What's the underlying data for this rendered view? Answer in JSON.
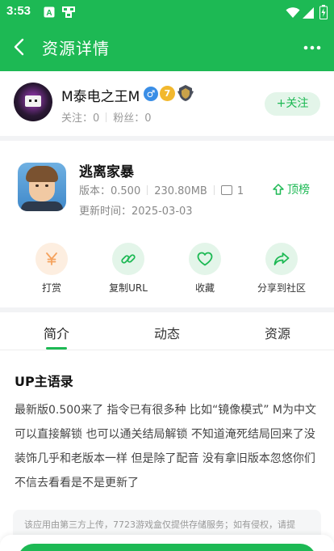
{
  "status_bar": {
    "time": "3:53"
  },
  "header": {
    "title": "资源详情"
  },
  "uploader": {
    "name": "M泰电之王M",
    "follow_label": "关注：0",
    "fans_label": "粉丝：0",
    "follow_button": "+关注",
    "medal_text": "7"
  },
  "app": {
    "name": "逃离家暴",
    "version": "版本：0.500",
    "size": "230.80MB",
    "image_count": "1",
    "update_time": "更新时间：2025-03-03",
    "top_button": "顶榜"
  },
  "actions": [
    {
      "label": "打赏",
      "icon": "yen-icon",
      "color": "#f5a25d",
      "bg": "#fdeee0"
    },
    {
      "label": "复制URL",
      "icon": "link-icon",
      "color": "#1db954",
      "bg": "#e3f5e9"
    },
    {
      "label": "收藏",
      "icon": "heart-icon",
      "color": "#1db954",
      "bg": "#e3f5e9"
    },
    {
      "label": "分享到社区",
      "icon": "share-icon",
      "color": "#1db954",
      "bg": "#e3f5e9"
    }
  ],
  "tabs": [
    {
      "label": "简介",
      "active": true
    },
    {
      "label": "动态",
      "active": false
    },
    {
      "label": "资源",
      "active": false
    }
  ],
  "description": {
    "title": "UP主语录",
    "text": "最新版0.500来了 指令已有很多种 比如“镜像模式” M为中文 可以直接解锁 也可以通关结局解锁 不知道淹死结局回来了没 装饰几乎和老版本一样 但是除了配音 没有拿旧版本忽悠你们 不信去看看是不是更新了"
  },
  "notice": "该应用由第三方上传，7723游戏盒仅提供存储服务；如有侵权，请提",
  "colors": {
    "accent": "#1db954",
    "accent_light": "#e3f5e9"
  }
}
